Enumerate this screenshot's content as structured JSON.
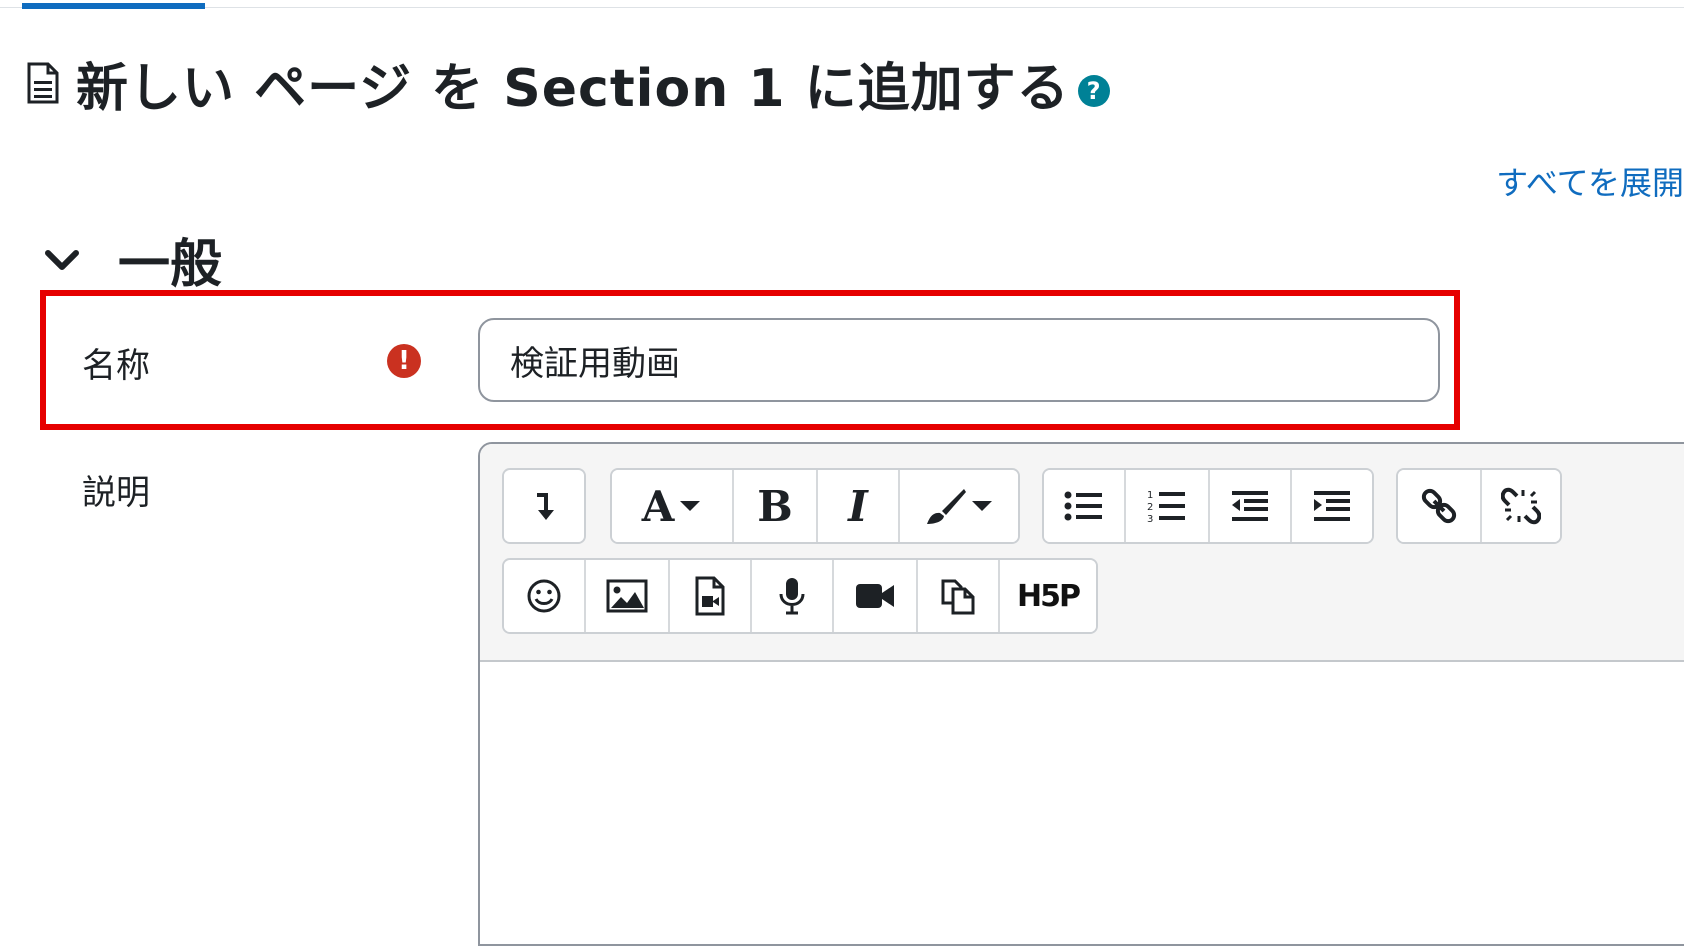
{
  "page": {
    "title": "新しい ページ を Section 1 に追加する",
    "help_icon": "question-circle-icon",
    "expand_all": "すべてを展開"
  },
  "section": {
    "title": "一般",
    "toggle_icon": "chevron-down-icon"
  },
  "fields": {
    "name": {
      "label": "名称",
      "value": "検証用動画",
      "required_icon": "exclamation-circle-icon"
    },
    "description": {
      "label": "説明"
    }
  },
  "toolbar": {
    "row1": {
      "group1": [
        {
          "icon": "collapse-arrow-icon"
        }
      ],
      "group2": [
        {
          "icon": "font-style-icon",
          "text": "A"
        },
        {
          "icon": "bold-icon",
          "text": "B"
        },
        {
          "icon": "italic-icon",
          "text": "I"
        },
        {
          "icon": "brush-icon"
        }
      ],
      "group3": [
        {
          "icon": "unordered-list-icon"
        },
        {
          "icon": "ordered-list-icon"
        },
        {
          "icon": "outdent-icon"
        },
        {
          "icon": "indent-icon"
        }
      ],
      "group4": [
        {
          "icon": "link-icon"
        },
        {
          "icon": "unlink-icon"
        }
      ]
    },
    "row2": {
      "group1": [
        {
          "icon": "emoji-icon"
        },
        {
          "icon": "image-icon"
        },
        {
          "icon": "media-file-icon"
        },
        {
          "icon": "microphone-icon"
        },
        {
          "icon": "video-camera-icon"
        },
        {
          "icon": "manage-files-icon"
        },
        {
          "icon": "h5p-icon",
          "text": "H5P"
        }
      ]
    }
  },
  "colors": {
    "accent": "#0f6cbf",
    "highlight": "#e60000",
    "required": "#ca3120",
    "help": "#008196"
  }
}
